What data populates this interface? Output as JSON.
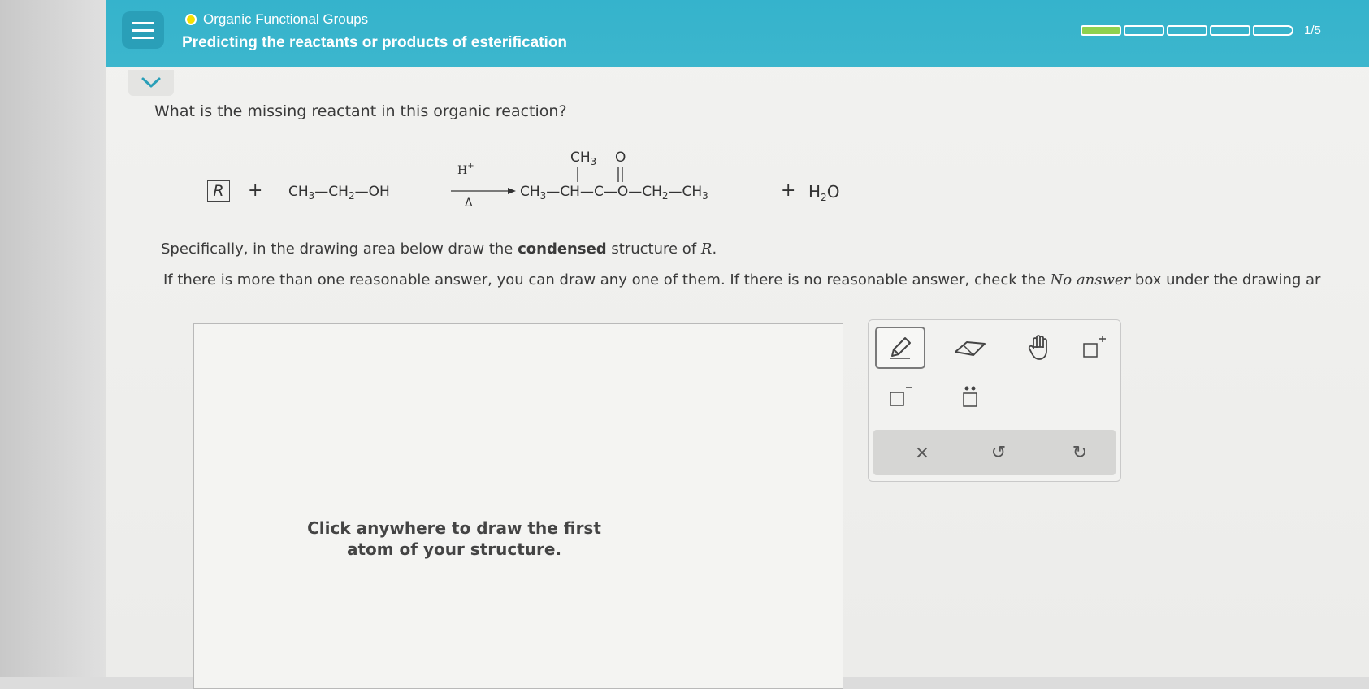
{
  "header": {
    "topic": "Organic Functional Groups",
    "lesson_title": "Predicting the reactants or products of esterification",
    "progress_text": "1/5",
    "progress": {
      "current": 1,
      "total": 5
    }
  },
  "question": {
    "prompt": "What is the missing reactant in this organic reaction?",
    "reaction": {
      "unknown": "R",
      "plus1": "+",
      "reactant2": {
        "ch3": "CH",
        "ch3_sub": "3",
        "ch2": "CH",
        "ch2_sub": "2",
        "oh": "OH",
        "bond": "—"
      },
      "arrow_top": "H",
      "arrow_top_sup": "+",
      "arrow_bottom": "Δ",
      "product": {
        "branch_ch3": "CH",
        "branch_ch3_sub": "3",
        "carbonyl_o": "O",
        "ch3": "CH",
        "ch3_sub": "3",
        "ch": "CH",
        "c": "C",
        "o": "O",
        "ch2": "CH",
        "ch2_sub": "2",
        "ch3b": "CH",
        "ch3b_sub": "3"
      },
      "plus2": "+",
      "water": {
        "h": "H",
        "sub": "2",
        "o": "O"
      }
    },
    "instruction_pre": "Specifically, in the drawing area below draw the ",
    "instruction_bold": "condensed",
    "instruction_post": " structure of ",
    "instruction_var": "R",
    "instruction_end": ".",
    "note_pre": "If there is more than one reasonable answer, you can draw any one of them. If there is no reasonable answer, check the ",
    "note_italic": "No answer",
    "note_post": " box under the drawing ar"
  },
  "drawing_area": {
    "hint_line1": "Click anywhere to draw the first",
    "hint_line2": "atom of your structure."
  },
  "palette": {
    "tools": [
      "pencil-icon",
      "eraser-icon",
      "hand-icon",
      "positive-charge-icon",
      "negative-charge-icon",
      "lone-pair-icon"
    ],
    "actions": {
      "clear": "×",
      "undo": "↺",
      "redo": "↻"
    }
  }
}
